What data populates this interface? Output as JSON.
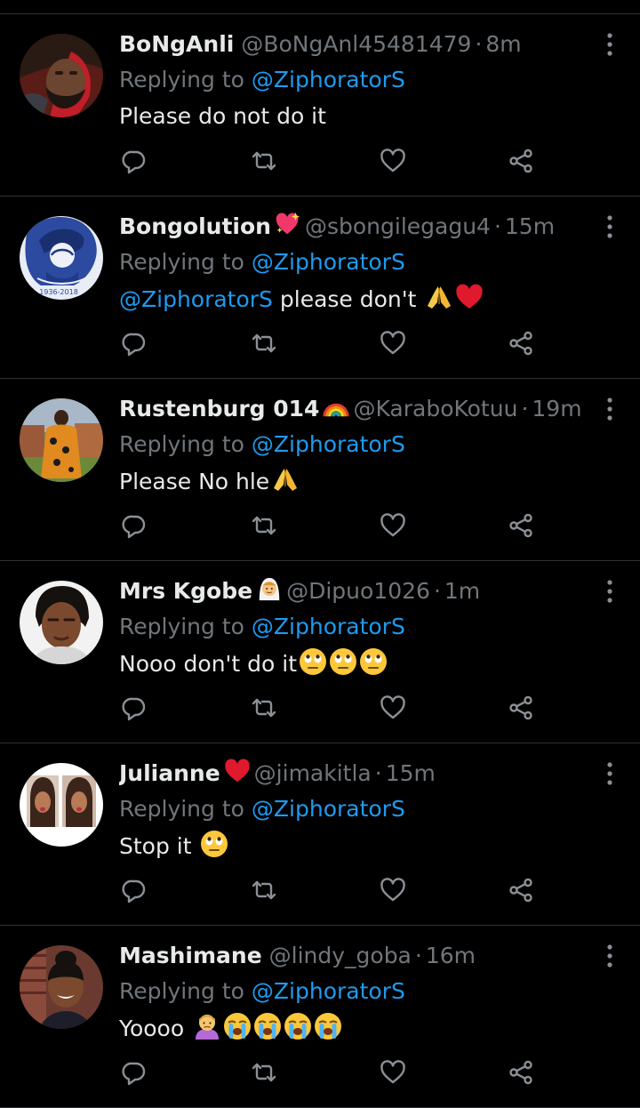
{
  "colors": {
    "background": "#000000",
    "text_primary": "#e7e9ea",
    "text_secondary": "#71767b",
    "link": "#1d9bf0",
    "divider": "#2f3336"
  },
  "icons": {
    "reply": "comment-bubble-icon",
    "retweet": "retweet-icon",
    "like": "heart-icon",
    "share": "share-icon",
    "more": "more-vertical-icon"
  },
  "replies": [
    {
      "name": "BoNgAnli",
      "handle": "@BoNgAnl45481479",
      "time": "8m",
      "replying_prefix": "Replying to",
      "replying_to": "@ZiphoratorS",
      "body_mention": "",
      "body_text": "Please do not do it",
      "name_badge": "",
      "body_emojis": []
    },
    {
      "name": "Bongolution",
      "handle": "@sbongilegagu4",
      "time": "15m",
      "replying_prefix": "Replying to",
      "replying_to": "@ZiphoratorS",
      "body_mention": "@ZiphoratorS",
      "body_text": " please don't ",
      "name_badge": "sparkling-heart",
      "body_emojis": [
        "folded-hands",
        "red-heart"
      ]
    },
    {
      "name": "Rustenburg 014",
      "handle": "@KaraboKotuu",
      "time": "19m",
      "replying_prefix": "Replying to",
      "replying_to": "@ZiphoratorS",
      "body_mention": "",
      "body_text": "Please No hle",
      "name_badge": "rainbow",
      "body_emojis": [
        "folded-hands"
      ]
    },
    {
      "name": "Mrs Kgobe",
      "handle": "@Dipuo1026",
      "time": "1m",
      "replying_prefix": "Replying to",
      "replying_to": "@ZiphoratorS",
      "body_mention": "",
      "body_text": "Nooo don't do it",
      "name_badge": "bride-with-veil",
      "body_emojis": [
        "face-rolling-eyes",
        "face-rolling-eyes",
        "face-rolling-eyes"
      ]
    },
    {
      "name": "Julianne",
      "handle": "@jimakitla",
      "time": "15m",
      "replying_prefix": "Replying to",
      "replying_to": "@ZiphoratorS",
      "body_mention": "",
      "body_text": "Stop it ",
      "name_badge": "red-heart",
      "body_emojis": [
        "face-rolling-eyes"
      ]
    },
    {
      "name": "Mashimane",
      "handle": "@lindy_goba",
      "time": "16m",
      "replying_prefix": "Replying to",
      "replying_to": "@ZiphoratorS",
      "body_mention": "",
      "body_text": "Yoooo ",
      "name_badge": "",
      "body_emojis": [
        "person-frowning",
        "loudly-crying-face",
        "loudly-crying-face",
        "loudly-crying-face",
        "loudly-crying-face"
      ]
    }
  ]
}
